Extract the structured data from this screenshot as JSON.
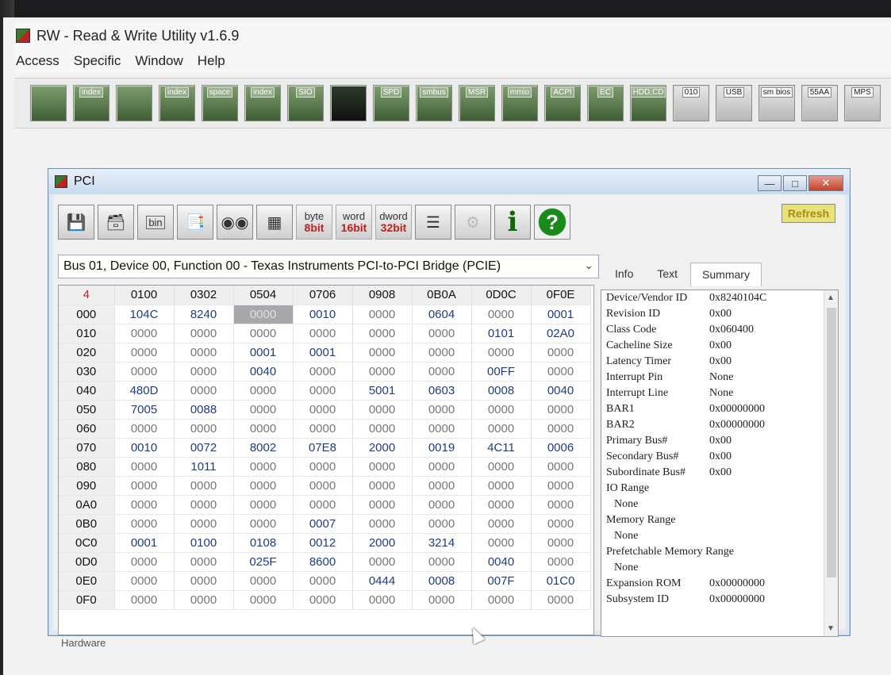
{
  "app": {
    "title": "RW - Read & Write Utility v1.6.9"
  },
  "menu": [
    "Access",
    "Specific",
    "Window",
    "Help"
  ],
  "toolbar": {
    "buttons": [
      {
        "name": "pci-icon",
        "tag": ""
      },
      {
        "name": "pci-index-icon",
        "tag": "index"
      },
      {
        "name": "memory-icon",
        "tag": ""
      },
      {
        "name": "memory-index-icon",
        "tag": "index"
      },
      {
        "name": "io-space-icon",
        "tag": "space"
      },
      {
        "name": "io-index-icon",
        "tag": "index"
      },
      {
        "name": "sio-icon",
        "tag": "SIO"
      },
      {
        "name": "waveform-icon",
        "tag": ""
      },
      {
        "name": "spd-icon",
        "tag": "SPD"
      },
      {
        "name": "smbus-icon",
        "tag": "smbus"
      },
      {
        "name": "msr-icon",
        "tag": "MSR"
      },
      {
        "name": "mmio-icon",
        "tag": "mmio"
      },
      {
        "name": "acpi-icon",
        "tag": "ACPI"
      },
      {
        "name": "ec-icon",
        "tag": "EC"
      },
      {
        "name": "hdd-cd-icon",
        "tag": "HDD,CD"
      },
      {
        "name": "binary-disk-icon",
        "tag": "010"
      },
      {
        "name": "usb-icon",
        "tag": "USB"
      },
      {
        "name": "smbios-icon",
        "tag": "sm bios"
      },
      {
        "name": "55aa-icon",
        "tag": "55AA"
      },
      {
        "name": "mps-icon",
        "tag": "MPS"
      }
    ]
  },
  "pci": {
    "title": "PCI",
    "refresh_label": "Refresh",
    "size_buttons": [
      {
        "top": "byte",
        "bottom": "8bit"
      },
      {
        "top": "word",
        "bottom": "16bit"
      },
      {
        "top": "dword",
        "bottom": "32bit"
      }
    ],
    "bin_label": "bin",
    "info_glyph": "i",
    "help_glyph": "?",
    "device": "Bus 01, Device 00, Function 00 - Texas Instruments PCI-to-PCI Bridge (PCIE)",
    "tabs": [
      "Info",
      "Text",
      "Summary"
    ],
    "status": "Hardware",
    "corner": "4",
    "columns": [
      "0100",
      "0302",
      "0504",
      "0706",
      "0908",
      "0B0A",
      "0D0C",
      "0F0E"
    ],
    "rows": [
      {
        "addr": "000",
        "cells": [
          "104C",
          "8240",
          "0000",
          "0010",
          "0000",
          "0604",
          "0000",
          "0001"
        ]
      },
      {
        "addr": "010",
        "cells": [
          "0000",
          "0000",
          "0000",
          "0000",
          "0000",
          "0000",
          "0101",
          "02A0"
        ]
      },
      {
        "addr": "020",
        "cells": [
          "0000",
          "0000",
          "0001",
          "0001",
          "0000",
          "0000",
          "0000",
          "0000"
        ]
      },
      {
        "addr": "030",
        "cells": [
          "0000",
          "0000",
          "0040",
          "0000",
          "0000",
          "0000",
          "00FF",
          "0000"
        ]
      },
      {
        "addr": "040",
        "cells": [
          "480D",
          "0000",
          "0000",
          "0000",
          "5001",
          "0603",
          "0008",
          "0040"
        ]
      },
      {
        "addr": "050",
        "cells": [
          "7005",
          "0088",
          "0000",
          "0000",
          "0000",
          "0000",
          "0000",
          "0000"
        ]
      },
      {
        "addr": "060",
        "cells": [
          "0000",
          "0000",
          "0000",
          "0000",
          "0000",
          "0000",
          "0000",
          "0000"
        ]
      },
      {
        "addr": "070",
        "cells": [
          "0010",
          "0072",
          "8002",
          "07E8",
          "2000",
          "0019",
          "4C11",
          "0006"
        ]
      },
      {
        "addr": "080",
        "cells": [
          "0000",
          "1011",
          "0000",
          "0000",
          "0000",
          "0000",
          "0000",
          "0000"
        ]
      },
      {
        "addr": "090",
        "cells": [
          "0000",
          "0000",
          "0000",
          "0000",
          "0000",
          "0000",
          "0000",
          "0000"
        ]
      },
      {
        "addr": "0A0",
        "cells": [
          "0000",
          "0000",
          "0000",
          "0000",
          "0000",
          "0000",
          "0000",
          "0000"
        ]
      },
      {
        "addr": "0B0",
        "cells": [
          "0000",
          "0000",
          "0000",
          "0007",
          "0000",
          "0000",
          "0000",
          "0000"
        ]
      },
      {
        "addr": "0C0",
        "cells": [
          "0001",
          "0100",
          "0108",
          "0012",
          "2000",
          "3214",
          "0000",
          "0000"
        ]
      },
      {
        "addr": "0D0",
        "cells": [
          "0000",
          "0000",
          "025F",
          "8600",
          "0000",
          "0000",
          "0040",
          "0000"
        ]
      },
      {
        "addr": "0E0",
        "cells": [
          "0000",
          "0000",
          "0000",
          "0000",
          "0444",
          "0008",
          "007F",
          "01C0"
        ]
      },
      {
        "addr": "0F0",
        "cells": [
          "0000",
          "0000",
          "0000",
          "0000",
          "0000",
          "0000",
          "0000",
          "0000"
        ]
      }
    ],
    "selected": {
      "row": 0,
      "col": 2
    },
    "summary": [
      {
        "k": "Device/Vendor ID",
        "v": "0x8240104C"
      },
      {
        "k": "Revision ID",
        "v": "0x00"
      },
      {
        "k": "Class Code",
        "v": "0x060400"
      },
      {
        "k": "Cacheline Size",
        "v": "0x00"
      },
      {
        "k": "Latency Timer",
        "v": "0x00"
      },
      {
        "k": "Interrupt Pin",
        "v": "None"
      },
      {
        "k": "Interrupt Line",
        "v": "None"
      },
      {
        "k": "BAR1",
        "v": "0x00000000"
      },
      {
        "k": "BAR2",
        "v": "0x00000000"
      },
      {
        "k": "Primary Bus#",
        "v": "0x00"
      },
      {
        "k": "Secondary Bus#",
        "v": "0x00"
      },
      {
        "k": "Subordinate Bus#",
        "v": "0x00"
      },
      {
        "k": "IO Range",
        "v": ""
      },
      {
        "k": "None",
        "v": "",
        "indent": true
      },
      {
        "k": "Memory Range",
        "v": ""
      },
      {
        "k": "None",
        "v": "",
        "indent": true
      },
      {
        "k": "Prefetchable Memory Range",
        "v": ""
      },
      {
        "k": "None",
        "v": "",
        "indent": true
      },
      {
        "k": "Expansion ROM",
        "v": "0x00000000"
      },
      {
        "k": "Subsystem ID",
        "v": "0x00000000"
      }
    ]
  }
}
